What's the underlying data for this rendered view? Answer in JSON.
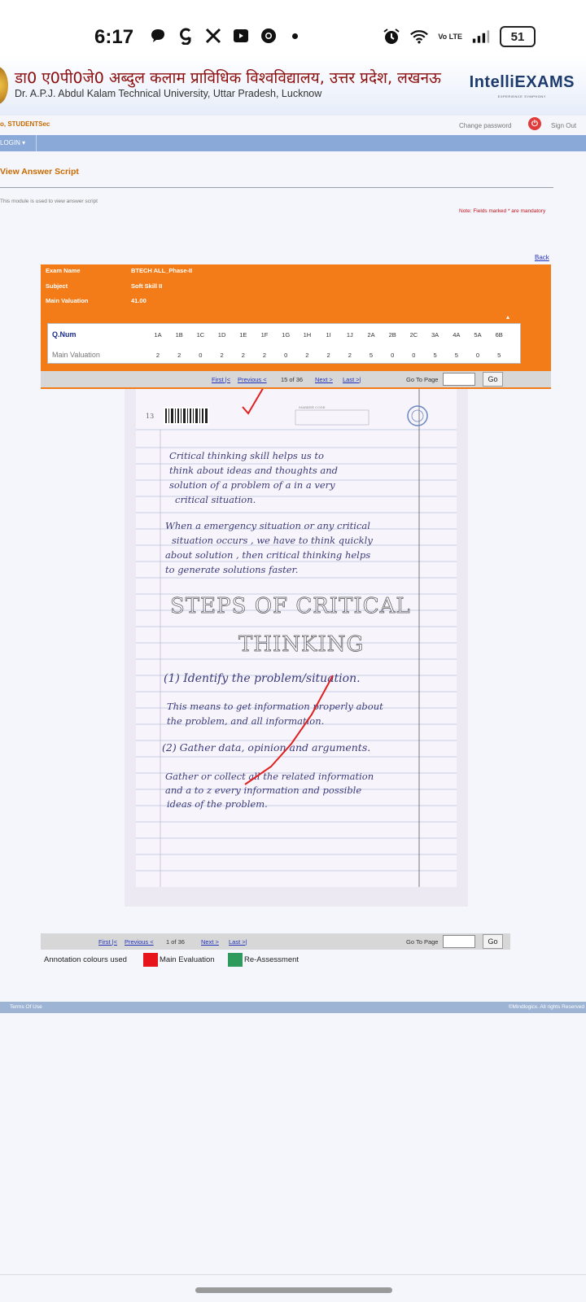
{
  "status_bar": {
    "time": "6:17",
    "battery": "51",
    "network_label": "Vo LTE",
    "icons": [
      "chat-icon",
      "g-icon",
      "x-icon",
      "video-icon",
      "chrome-icon",
      "dot-icon",
      "alarm-icon",
      "wifi-icon",
      "signal-icon",
      "battery-icon"
    ]
  },
  "header": {
    "hindi_title": "डा0 ए0पी0जे0 अब्दुल कलाम प्राविधिक विश्वविद्यालय, उत्तर प्रदेश, लखनऊ",
    "english_title": "Dr. A.P.J. Abdul Kalam Technical University, Uttar Pradesh, Lucknow",
    "brand": "IntelliEXAMS",
    "brand_tagline": "EXPERIENCE SYMPHONY"
  },
  "user_bar": {
    "user_name": "o, STUDENTSec",
    "change_password": "Change password",
    "sign_out": "Sign Out"
  },
  "nav": {
    "login_menu": "LOGIN ▾"
  },
  "page": {
    "heading": "View Answer Script",
    "description": "This module is used to view answer script",
    "mandatory_note": "Note: Fields marked * are mandatory",
    "back_link": "Back"
  },
  "exam_info": {
    "exam_name_label": "Exam Name",
    "exam_name_value": "BTECH ALL_Phase-II",
    "subject_label": "Subject",
    "subject_value": "Soft Skill II",
    "valuation_label": "Main Valuation",
    "valuation_value": "41.00"
  },
  "marks_table": {
    "qnum_label": "Q.Num",
    "row_label": "Main Valuation",
    "questions": [
      "1A",
      "1B",
      "1C",
      "1D",
      "1E",
      "1F",
      "1G",
      "1H",
      "1I",
      "1J",
      "2A",
      "2B",
      "2C",
      "3A",
      "4A",
      "5A",
      "6B"
    ],
    "marks": [
      "2",
      "2",
      "0",
      "2",
      "2",
      "2",
      "0",
      "2",
      "2",
      "2",
      "5",
      "0",
      "0",
      "5",
      "5",
      "0",
      "5"
    ]
  },
  "pager_top": {
    "first": "First |<",
    "previous": "Previous <",
    "page_status": "15 of 36",
    "next": "Next >",
    "last": "Last >|",
    "goto_label": "Go To Page",
    "go_button": "Go",
    "goto_value": ""
  },
  "answer_sheet": {
    "page_number": "13",
    "marker_box_label": "MARKER CODE",
    "line1": "Critical thinking skill helps us to",
    "line2": "think about ideas and thoughts and",
    "line3": "solution of a problem of a in a very",
    "line4": "critical situation.",
    "line5": "When a emergency situation or any critical",
    "line6": "situation occurs , we have to think quickly",
    "line7": "about solution , then critical thinking helps",
    "line8": "to generate solutions faster.",
    "heading1": "STEPS OF CRITICAL",
    "heading2": "THINKING",
    "step1": "(1) Identify the problem/situation.",
    "line9": "This means to get information properly about",
    "line10": "the problem, and all information.",
    "step2": "(2) Gather data, opinion and arguments.",
    "line11": "Gather or collect all the related information",
    "line12": "and a to z every information and possible",
    "line13": "ideas of the problem."
  },
  "pager_bottom": {
    "first": "First |<",
    "previous": "Previous <",
    "page_status": "1 of 36",
    "next": "Next >",
    "last": "Last >|",
    "goto_label": "Go To Page",
    "go_button": "Go",
    "goto_value": ""
  },
  "legend": {
    "title": "Annotation colours used",
    "main_label": "Main Evaluation",
    "main_color": "#e8141c",
    "reassess_label": "Re-Assessment",
    "reassess_color": "#2e9a5c"
  },
  "footer": {
    "terms": "Terms Of Use",
    "copyright": "©Mindlogicx. All rights Reserved"
  }
}
